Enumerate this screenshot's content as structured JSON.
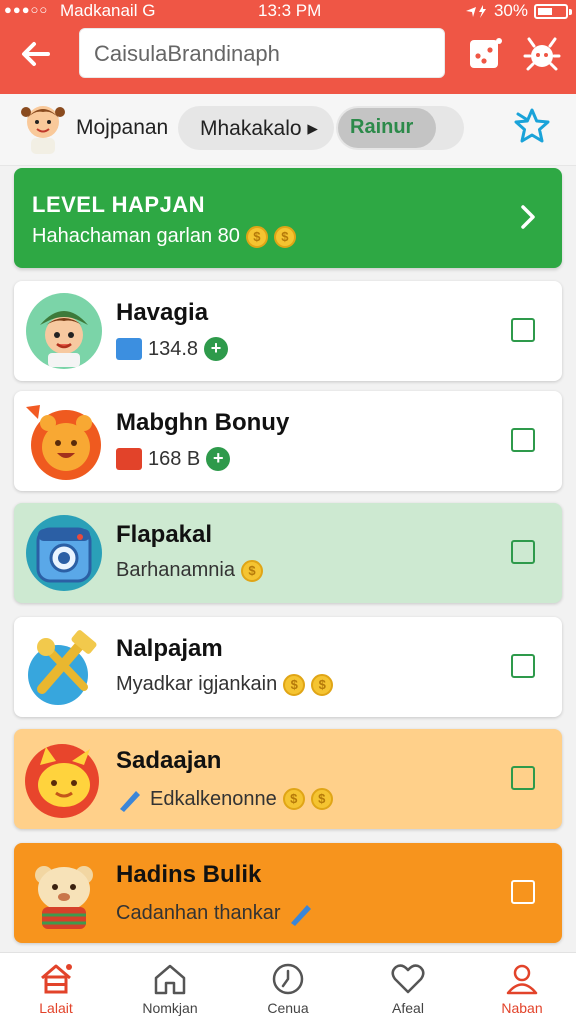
{
  "status_bar": {
    "carrier": "Madkanail  G",
    "time": "13:3 PM",
    "battery": "30%"
  },
  "header": {
    "search_value": "CaisulaBrandinaph",
    "icons": [
      "back-arrow-icon",
      "dice-icon",
      "bug-icon"
    ]
  },
  "tabs": [
    {
      "label": "Mojpanan"
    },
    {
      "label": "Mhakakalo ▸"
    },
    {
      "label": "Rainur",
      "selected": true
    }
  ],
  "banner": {
    "title": "LEVEL HAPJAN",
    "subtitle": "Hahachaman garlan 80",
    "color": "#2ea844"
  },
  "items": [
    {
      "name": "Havagia",
      "sub": "134.8",
      "color": "#ffffff"
    },
    {
      "name": "Mabghn Bonuy",
      "sub": "168 B",
      "color": "#ffffff"
    },
    {
      "name": "Flapakal",
      "sub": "Barhanamnia",
      "color": "#cde9d1"
    },
    {
      "name": "Nalpajam",
      "sub": "Myadkar igjankain",
      "color": "#ffffff"
    },
    {
      "name": "Sadaajan",
      "sub": "Edkalkenonne",
      "color": "#ffd08a"
    },
    {
      "name": "Hadins Bulik",
      "sub": "Cadanhan thankar",
      "color": "#f7941d"
    }
  ],
  "nav": [
    {
      "label": "Lalait",
      "icon": "home-icon",
      "active": true
    },
    {
      "label": "Nomkjan",
      "icon": "house-icon"
    },
    {
      "label": "Cenua",
      "icon": "clock-icon"
    },
    {
      "label": "Afeal",
      "icon": "heart-icon"
    },
    {
      "label": "Naban",
      "icon": "person-icon",
      "active": true
    }
  ],
  "accent": "#ef5645"
}
